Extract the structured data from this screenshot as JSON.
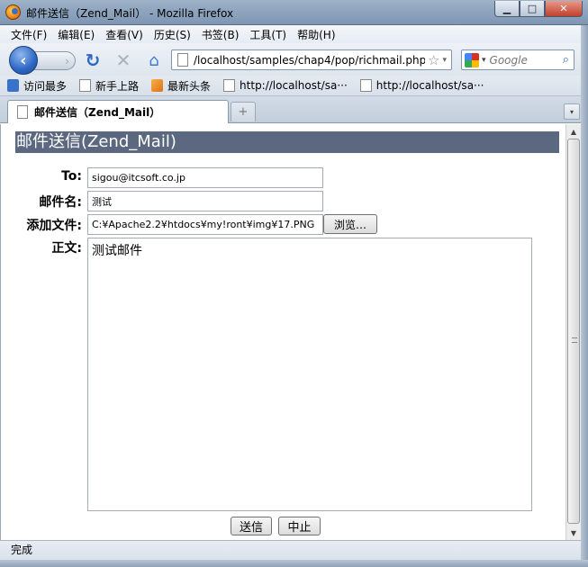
{
  "window": {
    "title": "邮件送信（Zend_Mail） - Mozilla Firefox",
    "minimize_label": "▁",
    "maximize_label": "□",
    "close_label": "✕"
  },
  "menu": [
    "文件(F)",
    "编辑(E)",
    "查看(V)",
    "历史(S)",
    "书签(B)",
    "工具(T)",
    "帮助(H)"
  ],
  "nav": {
    "back_glyph": "‹",
    "forward_glyph": "›",
    "reload_glyph": "↻",
    "stop_glyph": "✕",
    "home_glyph": "⌂",
    "url": "/localhost/samples/chap4/pop/richmail.php",
    "star_glyph": "☆",
    "dropdown_glyph": "▾",
    "search_placeholder": "Google",
    "search_glyph": "⌕"
  },
  "bookmarks": [
    {
      "label": "访问最多",
      "icon": "magnifier-icon"
    },
    {
      "label": "新手上路",
      "icon": "page-icon"
    },
    {
      "label": "最新头条",
      "icon": "rss-icon"
    },
    {
      "label": "http://localhost/sa···",
      "icon": "page-icon"
    },
    {
      "label": "http://localhost/sa···",
      "icon": "page-icon"
    }
  ],
  "tab": {
    "label": "邮件送信（Zend_Mail）",
    "new_tab_glyph": "+",
    "list_glyph": "▾"
  },
  "page": {
    "title": "邮件送信(Zend_Mail)",
    "to_label": "To:",
    "to_value": "sigou@itcsoft.co.jp",
    "subject_label": "邮件名:",
    "subject_value": "测试",
    "attach_label": "添加文件:",
    "attach_value": "C:¥Apache2.2¥htdocs¥my!ront¥img¥17.PNG",
    "browse_label": "浏览…",
    "body_label": "正文:",
    "body_value": "测试邮件",
    "send_label": "送信",
    "cancel_label": "中止"
  },
  "scrollbar": {
    "up_glyph": "▲",
    "down_glyph": "▼"
  },
  "status": {
    "text": "完成"
  },
  "colors": {
    "title_bg": "#5b6880",
    "title_fg": "#ffffff",
    "window_chrome": "#8fa6bf"
  }
}
